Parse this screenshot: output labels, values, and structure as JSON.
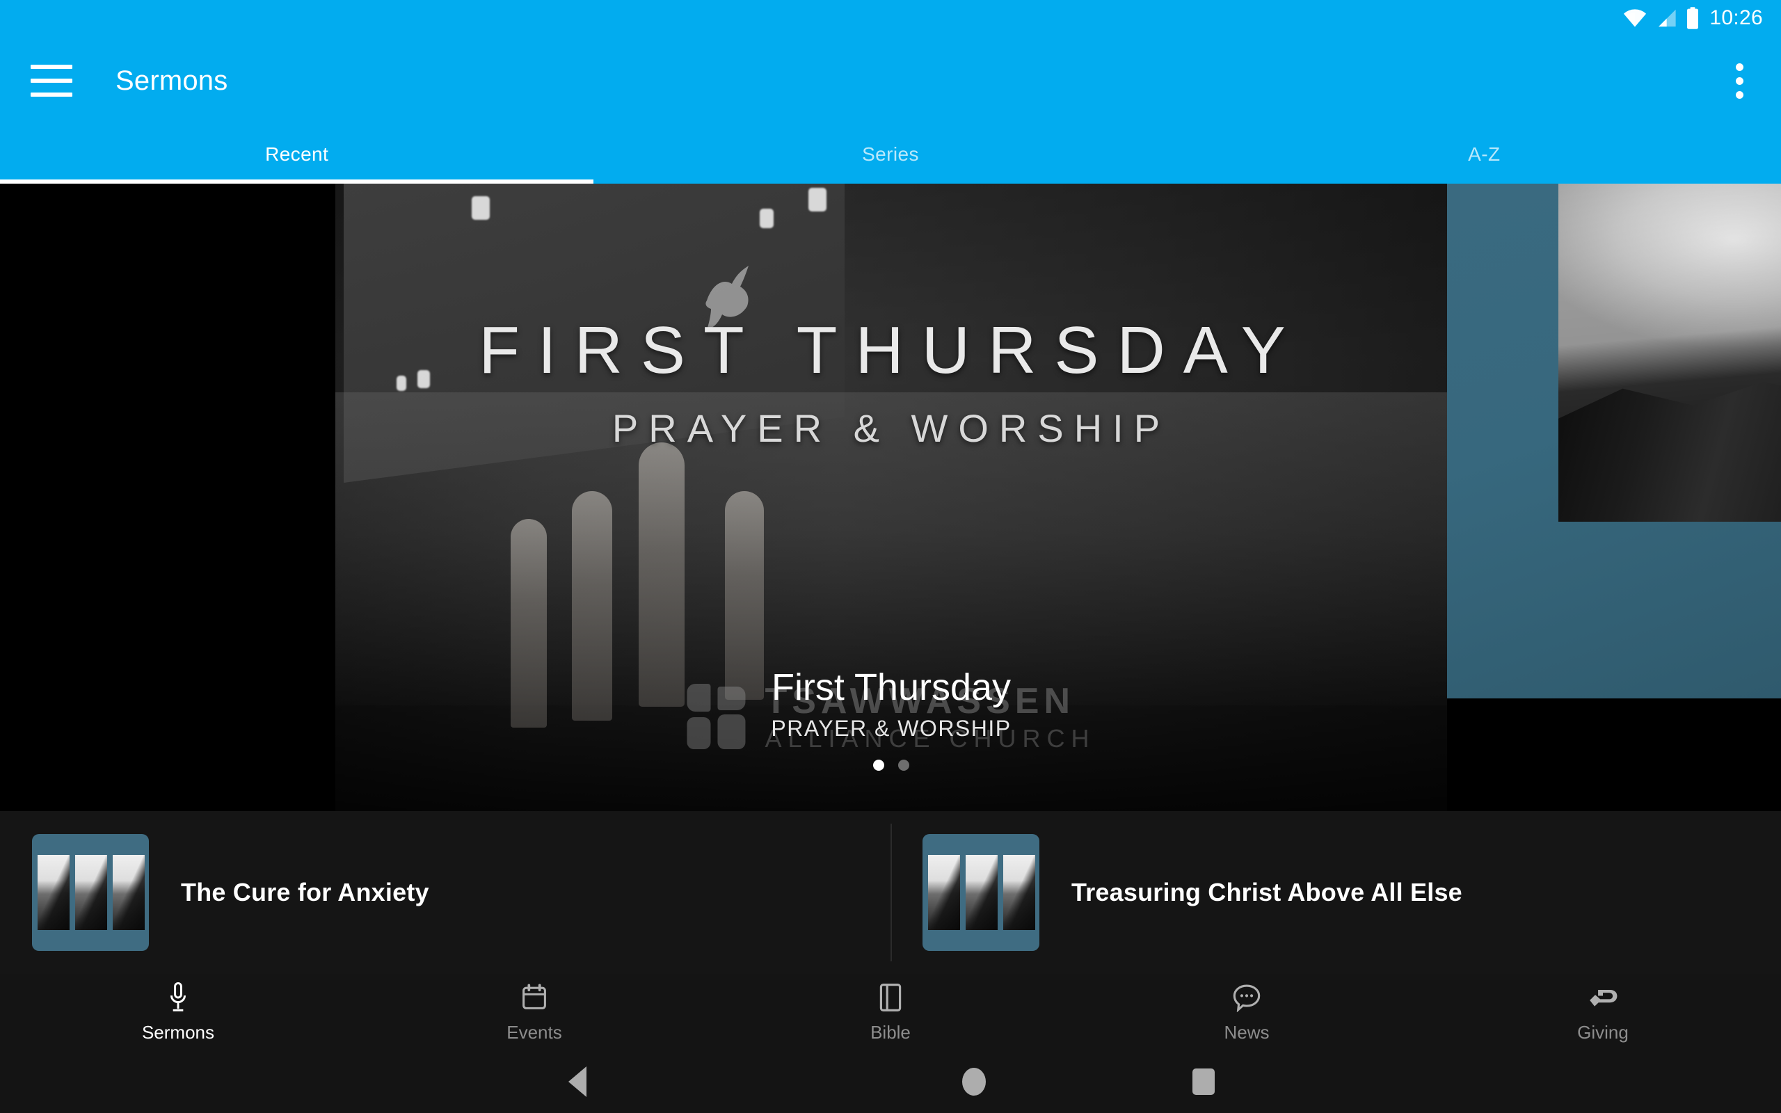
{
  "status_bar": {
    "clock": "10:26",
    "icons": [
      "wifi-icon",
      "cellular-signal-icon",
      "battery-icon"
    ]
  },
  "app_bar": {
    "menu_icon": "hamburger-menu-icon",
    "title": "Sermons",
    "overflow_icon": "overflow-menu-icon",
    "accent_color": "#02ACEF"
  },
  "tabs": {
    "items": [
      {
        "label": "Recent",
        "active": true
      },
      {
        "label": "Series",
        "active": false
      },
      {
        "label": "A-Z",
        "active": false
      }
    ]
  },
  "carousel": {
    "hero": {
      "banner_title": "FIRST THURSDAY",
      "banner_subtitle": "PRAYER & WORSHIP",
      "caption_title": "First Thursday",
      "caption_subtitle": "PRAYER & WORSHIP"
    },
    "watermark": {
      "line1": "TSAWWASSEN",
      "line2": "ALLIANCE CHURCH"
    },
    "pagination": {
      "total": 2,
      "current": 1
    }
  },
  "sermon_list": [
    {
      "title": "The Cure for Anxiety",
      "thumb": "mountain-triptych-thumbnail"
    },
    {
      "title": "Treasuring Christ Above All Else",
      "thumb": "mountain-triptych-thumbnail"
    }
  ],
  "bottom_nav": {
    "items": [
      {
        "label": "Sermons",
        "icon": "microphone-icon",
        "active": true
      },
      {
        "label": "Events",
        "icon": "calendar-icon",
        "active": false
      },
      {
        "label": "Bible",
        "icon": "book-icon",
        "active": false
      },
      {
        "label": "News",
        "icon": "chat-bubble-icon",
        "active": false
      },
      {
        "label": "Giving",
        "icon": "giving-hand-icon",
        "active": false
      }
    ],
    "active_color": "#ffffff",
    "inactive_color": "#8d8d8d"
  },
  "system_nav": {
    "back": "back-triangle-icon",
    "home": "home-circle-icon",
    "recents": "recents-square-icon"
  }
}
